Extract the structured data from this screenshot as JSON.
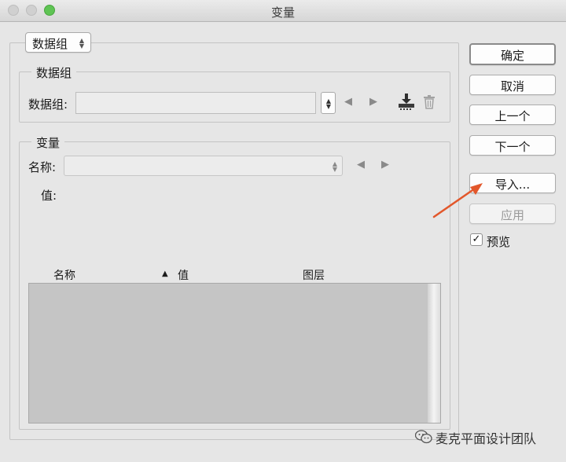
{
  "window": {
    "title": "变量"
  },
  "top_popup": {
    "selected": "数据组"
  },
  "data_group": {
    "legend": "数据组",
    "field_label": "数据组:",
    "field_value": ""
  },
  "variable_group": {
    "legend": "变量",
    "name_label": "名称:",
    "value_label": "值:",
    "name_value": ""
  },
  "table": {
    "columns": [
      "名称",
      "值",
      "图层"
    ],
    "sort_indicator": "▲",
    "rows": []
  },
  "buttons": {
    "ok": "确定",
    "cancel": "取消",
    "prev": "上一个",
    "next": "下一个",
    "import": "导入...",
    "apply": "应用"
  },
  "preview": {
    "label": "预览",
    "checked": true,
    "check_mark": "✓"
  },
  "watermark": {
    "text": "麦克平面设计团队"
  },
  "colors": {
    "annotation_arrow": "#e2572b",
    "window_bg": "#e6e6e6",
    "table_bg": "#c5c5c5",
    "zoom_button": "#5fc454"
  },
  "icons": {
    "import_icon": "import-icon",
    "trash_icon": "trash-icon",
    "prev_arrow": "◀",
    "next_arrow": "▶",
    "updown": "⬍"
  }
}
